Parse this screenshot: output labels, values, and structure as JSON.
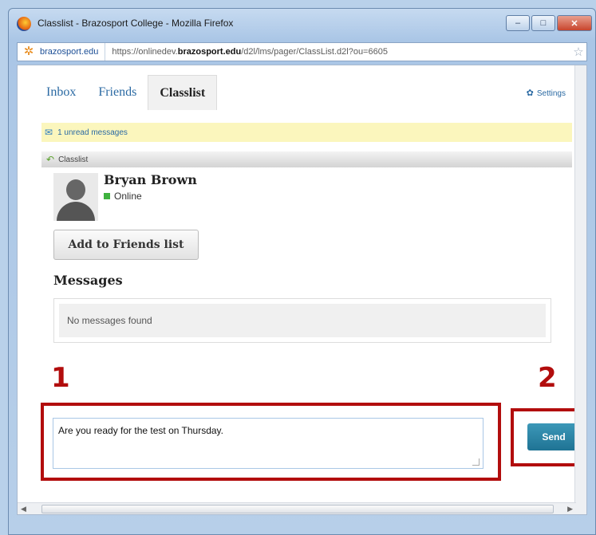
{
  "window": {
    "title": "Classlist - Brazosport College - Mozilla Firefox",
    "minimize": "–",
    "maximize": "□",
    "close": "✕"
  },
  "address_bar": {
    "site_label": "brazosport.edu",
    "url_prefix": "https://onlinedev.",
    "url_domain": "brazosport.edu",
    "url_path": "/d2l/lms/pager/ClassList.d2l?ou=6605"
  },
  "tabs": [
    {
      "label": "Inbox",
      "active": false
    },
    {
      "label": "Friends",
      "active": false
    },
    {
      "label": "Classlist",
      "active": true
    }
  ],
  "settings_label": "Settings",
  "unread_text": "1 unread messages",
  "section_title": "Classlist",
  "contact": {
    "name": "Bryan Brown",
    "status": "Online"
  },
  "add_friend_label": "Add to Friends list",
  "messages_heading": "Messages",
  "no_messages_text": "No messages found",
  "composer": {
    "text": "Are you ready for the test on Thursday.",
    "send_label": "Send"
  },
  "annotations": {
    "step1": "1",
    "step2": "2"
  },
  "colors": {
    "annotation_red": "#b20d0d",
    "send_button": "#1f7394",
    "online_status": "#3fb23f"
  }
}
